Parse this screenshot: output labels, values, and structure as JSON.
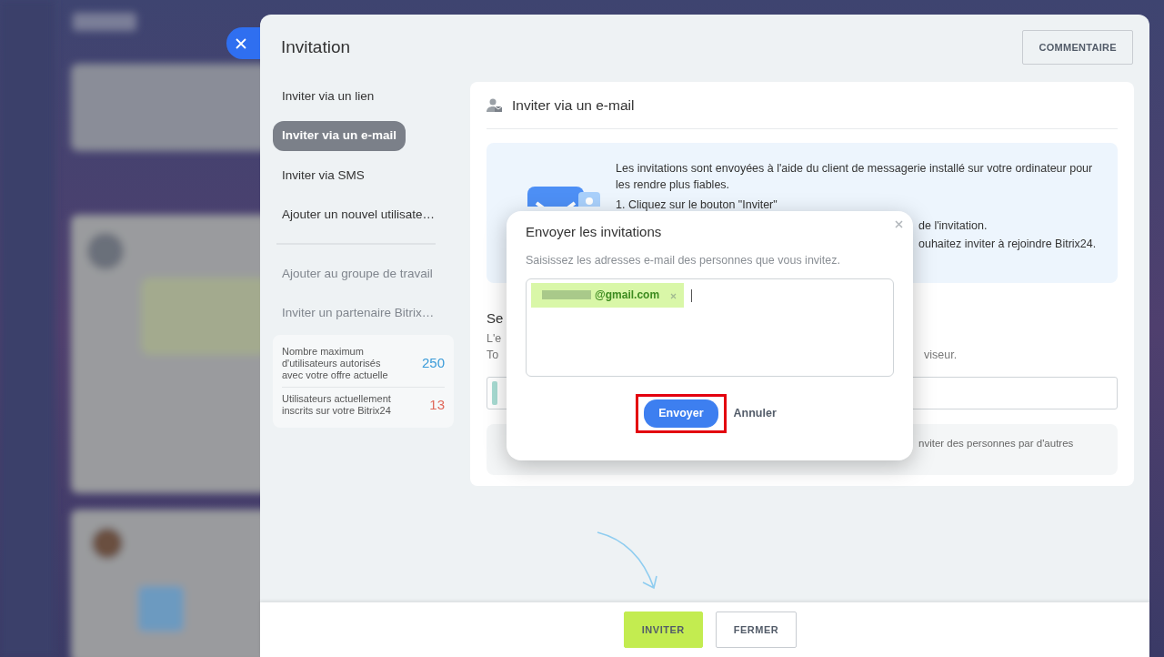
{
  "panel": {
    "title": "Invitation",
    "comment_button": "COMMENTAIRE",
    "nav": [
      {
        "label": "Inviter via un lien",
        "selected": false,
        "kind": "main"
      },
      {
        "label": "Inviter via un e-mail",
        "selected": true,
        "kind": "main"
      },
      {
        "label": "Inviter via SMS",
        "selected": false,
        "kind": "main"
      },
      {
        "label": "Ajouter un nouvel utilisate…",
        "selected": false,
        "kind": "main"
      },
      {
        "kind": "divider"
      },
      {
        "label": "Ajouter au groupe de travail",
        "selected": false,
        "kind": "secondary"
      },
      {
        "label": "Inviter un partenaire Bitrix…",
        "selected": false,
        "kind": "secondary"
      }
    ],
    "stats": [
      {
        "label": "Nombre maximum d'utilisateurs autorisés avec votre offre actuelle",
        "value": "250",
        "color": "#3a9bd9"
      },
      {
        "label": "Utilisateurs actuellement inscrits sur votre Bitrix24",
        "value": "13",
        "color": "#e0685a"
      }
    ],
    "section_title": "Inviter via un e-mail",
    "info_lines": [
      {
        "text": "Les invitations sont envoyées à l'aide du client de messagerie installé sur votre ordinateur pour les rendre plus fiables.",
        "kind": "full"
      },
      {
        "text": "1. Cliquez sur le bouton \"Inviter\"",
        "kind": "full"
      },
      {
        "text": "de l'invitation.",
        "kind": "tail"
      },
      {
        "text": "ouhaitez inviter à rejoindre Bitrix24.",
        "kind": "tail"
      }
    ],
    "below_rows": [
      {
        "left": "Se",
        "right": "",
        "kind": "heading"
      },
      {
        "left": "L'e",
        "right": "",
        "kind": "text"
      },
      {
        "left": "To",
        "right": "viseur.",
        "kind": "text"
      }
    ],
    "note_tail": "nviter des personnes par d'autres",
    "footer_buttons": [
      {
        "label": "INVITER",
        "kind": "primary"
      },
      {
        "label": "FERMER",
        "kind": "secondary"
      }
    ]
  },
  "popup": {
    "title": "Envoyer les invitations",
    "subtitle": "Saisissez les adresses e-mail des personnes que vous invitez.",
    "emails": [
      {
        "text": "@gmail.com",
        "redacted": true
      }
    ],
    "send_button": {
      "label": "Envoyer",
      "highlighted": true
    },
    "cancel_button": "Annuler"
  }
}
